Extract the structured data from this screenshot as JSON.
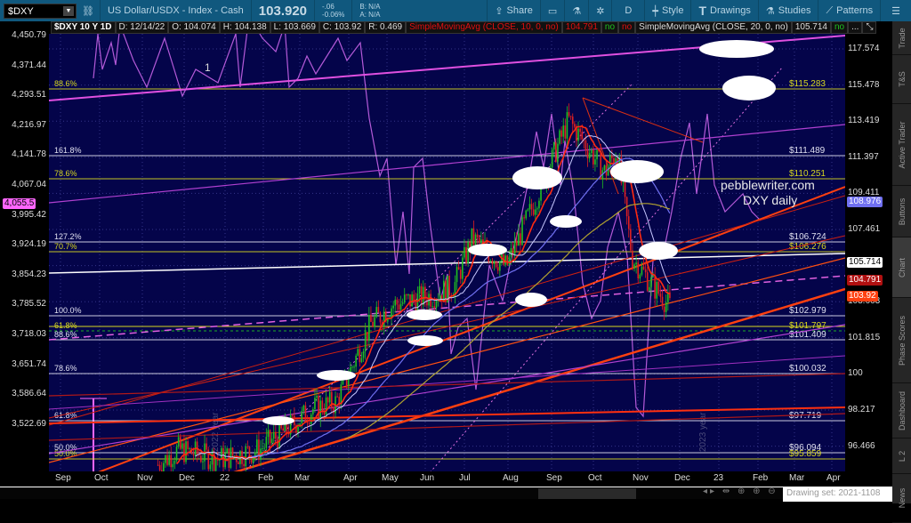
{
  "toolbar": {
    "symbol": "$DXY",
    "description": "US Dollar/USDX - Index - Cash",
    "last": "103.920",
    "change": "-.06",
    "change_pct": "-0.06%",
    "bid": "B: N/A",
    "ask": "A: N/A",
    "share": "Share",
    "period": "D",
    "style": "Style",
    "drawings": "Drawings",
    "studies": "Studies",
    "patterns": "Patterns"
  },
  "info": {
    "title": "$DXY 10 Y 1D",
    "date": "D: 12/14/22",
    "open": "O: 104.074",
    "high": "H: 104.138",
    "low": "L: 103.669",
    "close": "C: 103.92",
    "range": "R: 0.469",
    "sma10": "SimpleMovingAvg (CLOSE, 10, 0, no)",
    "sma10_val": "104.791",
    "no1": "no",
    "no2": "no",
    "sma20": "SimpleMovingAvg (CLOSE, 20, 0, no)",
    "sma20_val": "105.714",
    "no3": "no",
    "more": "..."
  },
  "chart_data": {
    "type": "candlestick",
    "title": "$DXY 10 Y 1D",
    "right_axis_ticks": [
      "117.574",
      "115.478",
      "113.419",
      "111.397",
      "109.411",
      "107.461",
      "105.543",
      "103.663",
      "101.815",
      "100",
      "98.217",
      "96.466"
    ],
    "left_axis_ticks": [
      "4,450.79",
      "4,371.44",
      "4,293.51",
      "4,216.97",
      "4,141.78",
      "4,067.04",
      "3,995.42",
      "3,924.19",
      "3,854.23",
      "3,785.52",
      "3,718.03",
      "3,651.74",
      "3,586.64",
      "3,522.69"
    ],
    "x_ticks": [
      "Sep",
      "Oct",
      "Nov",
      "Dec",
      "22",
      "Feb",
      "Mar",
      "Apr",
      "May",
      "Jun",
      "Jul",
      "Aug",
      "Sep",
      "Oct",
      "Nov",
      "Dec",
      "23",
      "Feb",
      "Mar",
      "Apr"
    ],
    "price_keypoints": [
      [
        "2021-11-15",
        95.5
      ],
      [
        "2021-12-01",
        96.3
      ],
      [
        "2022-01-01",
        95.8
      ],
      [
        "2022-02-01",
        96.3
      ],
      [
        "2022-03-15",
        98.5
      ],
      [
        "2022-04-01",
        98.8
      ],
      [
        "2022-04-28",
        103
      ],
      [
        "2022-05-15",
        104
      ],
      [
        "2022-06-15",
        104.5
      ],
      [
        "2022-07-01",
        105
      ],
      [
        "2022-07-15",
        107.5
      ],
      [
        "2022-08-10",
        106
      ],
      [
        "2022-08-29",
        109
      ],
      [
        "2022-09-27",
        113.8
      ],
      [
        "2022-10-10",
        112.5
      ],
      [
        "2022-10-25",
        111
      ],
      [
        "2022-11-03",
        112.2
      ],
      [
        "2022-11-15",
        106.5
      ],
      [
        "2022-12-01",
        105
      ],
      [
        "2022-12-14",
        103.92
      ]
    ],
    "fib_levels": [
      {
        "left": "88.6%",
        "right": "$115.283",
        "color": "#d8d820"
      },
      {
        "left": "161.8%",
        "right": "$111.489",
        "color": "#e0e0f0"
      },
      {
        "left": "78.6%",
        "right": "$110.251",
        "color": "#d8d820"
      },
      {
        "left": "127.2%",
        "right": "$106.724",
        "color": "#e0e0f0"
      },
      {
        "left": "70.7%",
        "right": "$106.276",
        "color": "#d8d820"
      },
      {
        "left": "100.0%",
        "right": "$102.979",
        "color": "#e0e0f0"
      },
      {
        "left": "61.8%",
        "right": "$101.797",
        "color": "#d8d820"
      },
      {
        "left": "88.6%",
        "right": "$101.409",
        "color": "#e0e0f0"
      },
      {
        "left": "78.6%",
        "right": "$100.032",
        "color": "#e0e0f0"
      },
      {
        "left": "61.8%",
        "right": "$97.719",
        "color": "#e0e0f0"
      },
      {
        "left": "50.0%",
        "right": "$96.094",
        "color": "#e0e0f0"
      },
      {
        "left": "50.0%",
        "right": "$95.859",
        "color": "#d8d820"
      }
    ],
    "badges": {
      "sma50": "108.976",
      "sma20": "105.714",
      "sma10": "104.791",
      "last": "103.92",
      "index": "4,055.5"
    },
    "annotations": {
      "label1": "1",
      "watermark1": "pebblewriter.com",
      "watermark2": "DXY daily",
      "year1": "2022 year",
      "year2": "2023 year"
    }
  },
  "colors": {
    "toolbar": "#10587e",
    "plot_bg": "#04044a",
    "up": "#20c020",
    "down": "#e02020"
  },
  "tabs": [
    "Trade",
    "T&S",
    "Active Trader",
    "Buttons",
    "Chart",
    "Phase Scores",
    "Dashboard",
    "L 2",
    "News"
  ],
  "drawing_set": "Drawing set: 2021-1108"
}
